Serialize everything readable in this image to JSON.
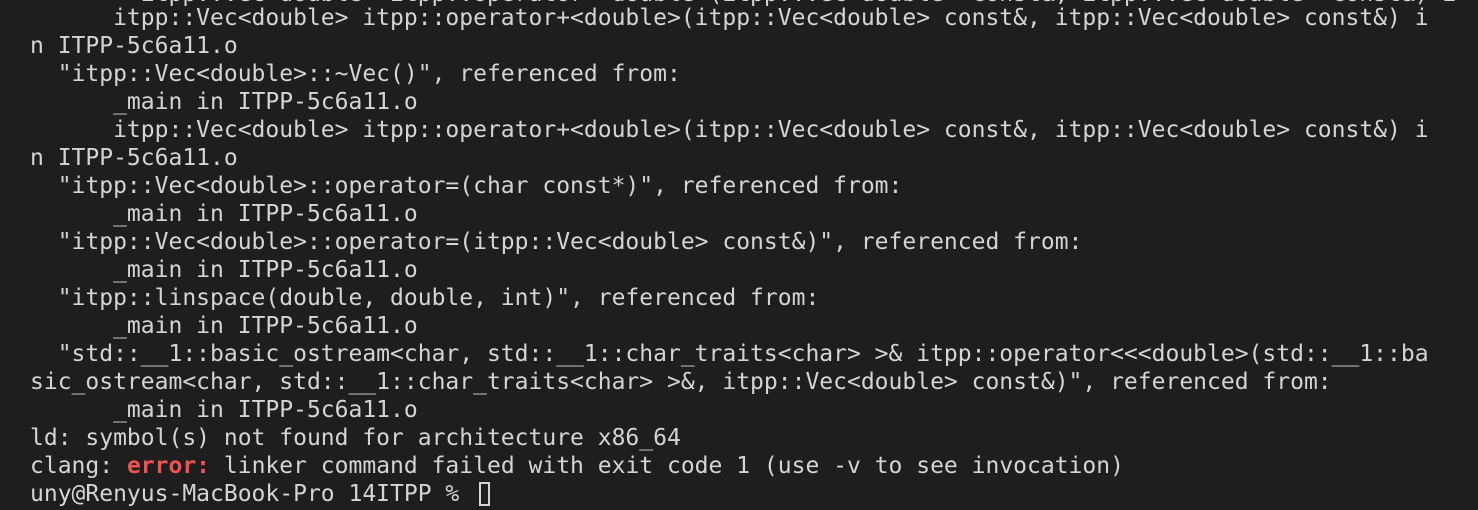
{
  "terminal": {
    "partial_top_line": "        itpp::Vec<double> itpp::operator+<double>(itpp::Vec<double> const&, itpp::Vec<double> const&) i",
    "lines": [
      "      itpp::Vec<double> itpp::operator+<double>(itpp::Vec<double> const&, itpp::Vec<double> const&) i",
      "n ITPP-5c6a11.o",
      "  \"itpp::Vec<double>::~Vec()\", referenced from:",
      "      _main in ITPP-5c6a11.o",
      "      itpp::Vec<double> itpp::operator+<double>(itpp::Vec<double> const&, itpp::Vec<double> const&) i",
      "n ITPP-5c6a11.o",
      "  \"itpp::Vec<double>::operator=(char const*)\", referenced from:",
      "      _main in ITPP-5c6a11.o",
      "  \"itpp::Vec<double>::operator=(itpp::Vec<double> const&)\", referenced from:",
      "      _main in ITPP-5c6a11.o",
      "  \"itpp::linspace(double, double, int)\", referenced from:",
      "      _main in ITPP-5c6a11.o",
      "  \"std::__1::basic_ostream<char, std::__1::char_traits<char> >& itpp::operator<<<double>(std::__1::ba",
      "sic_ostream<char, std::__1::char_traits<char> >&, itpp::Vec<double> const&)\", referenced from:",
      "      _main in ITPP-5c6a11.o",
      "ld: symbol(s) not found for architecture x86_64"
    ],
    "clang_line": {
      "prefix": "clang: ",
      "error_word": "error:",
      "message": " linker command failed with exit code 1 (use -v to see invocation)"
    },
    "prompt": "uny@Renyus-MacBook-Pro 14ITPP % ",
    "colors": {
      "background": "#1e1e1e",
      "text": "#d4d4d4",
      "error": "#f05252"
    }
  }
}
